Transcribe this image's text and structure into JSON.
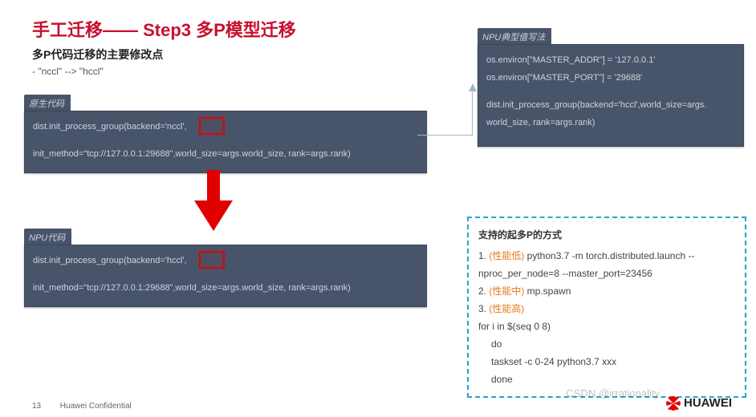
{
  "header": {
    "title": "手工迁移—— Step3 多P模型迁移",
    "subtitle": "多P代码迁移的主要修改点",
    "bullet": "- \"nccl\" --> \"hccl\""
  },
  "tags": {
    "original": "原生代码",
    "npu": "NPU代码",
    "typical": "NPU典型值写法"
  },
  "code": {
    "orig1": "dist.init_process_group(backend='nccl',",
    "orig2": "init_method=\"tcp://127.0.0.1:29688\",world_size=args.world_size, rank=args.rank)",
    "npu1": "dist.init_process_group(backend='hccl',",
    "npu2": "init_method=\"tcp://127.0.0.1:29688\",world_size=args.world_size, rank=args.rank)",
    "typ1": "os.environ[\"MASTER_ADDR\"] = '127.0.0.1'",
    "typ2": "os.environ[\"MASTER_PORT\"] = '29688'",
    "typ3": "dist.init_process_group(backend='hccl',world_size=args.",
    "typ4": "world_size, rank=args.rank)"
  },
  "info": {
    "header": "支持的起多P的方式",
    "l1a": "1. ",
    "l1b": "(性能低)",
    "l1c": " python3.7 -m torch.distributed.launch --",
    "l2": "nproc_per_node=8 --master_port=23456",
    "l3a": "2. ",
    "l3b": "(性能中)",
    "l3c": " mp.spawn",
    "l4a": "3. ",
    "l4b": "(性能高)",
    "l5": "for i in $(seq 0 8)",
    "l6": "do",
    "l7": "taskset -c 0-24 python3.7 xxx",
    "l8": "done"
  },
  "footer": {
    "page": "13",
    "conf": "Huawei Confidential",
    "logo": "HUAWEI",
    "watermark": "CSDN @irrationality"
  }
}
